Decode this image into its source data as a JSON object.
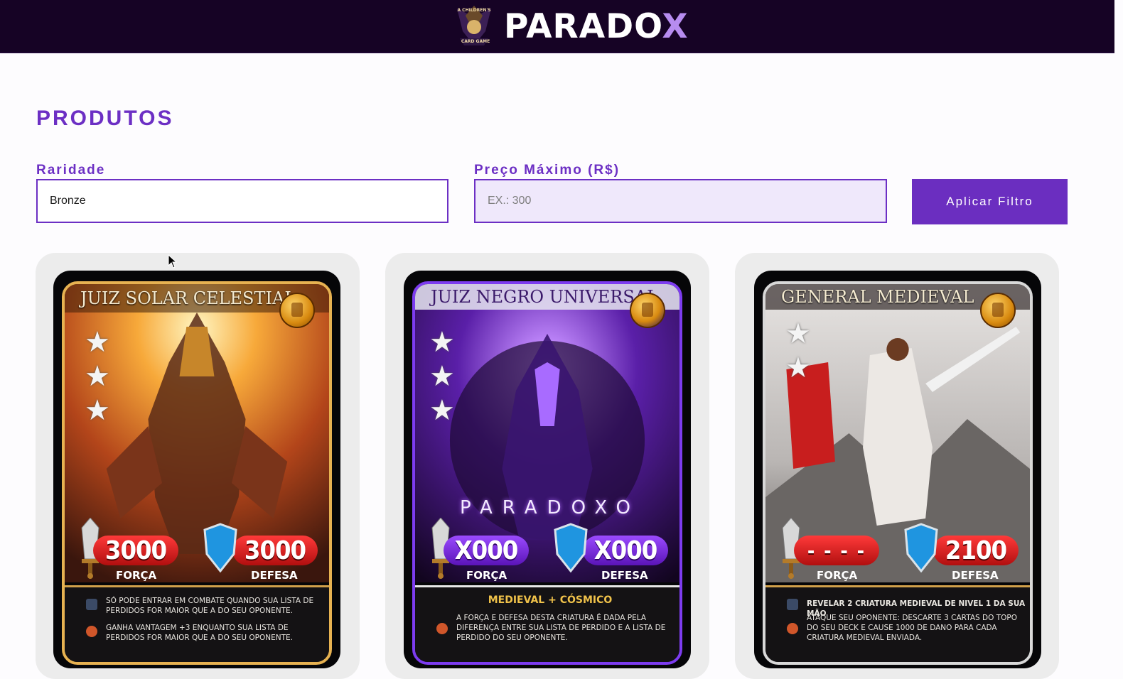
{
  "header": {
    "logo_text": "PARADO",
    "logo_accent": "X",
    "logo_mark_text": "A CHILDREN'S CARD GAME"
  },
  "page": {
    "title": "PRODUTOS"
  },
  "filters": {
    "rarity_label": "Raridade",
    "rarity_value": "Bronze",
    "price_label": "Preço Máximo (R$)",
    "price_placeholder": "EX.: 300",
    "apply_label": "Aplicar Filtro"
  },
  "colors": {
    "accent": "#6c2fc4",
    "header_bg": "#160325",
    "button": "#6b2ec0"
  },
  "cards": [
    {
      "name": "JUIZ SOLAR CELESTIAL",
      "stars": 3,
      "forca": "3000",
      "defesa": "3000",
      "forca_label": "FORÇA",
      "defesa_label": "DEFESA",
      "effects": [
        "SÓ PODE ENTRAR EM COMBATE QUANDO SUA LISTA DE PERDIDOS FOR MAIOR QUE A DO SEU OPONENTE.",
        "GANHA VANTAGEM +3 ENQUANTO SUA LISTA DE PERDIDOS FOR MAIOR QUE A DO SEU OPONENTE."
      ]
    },
    {
      "name": "JUIZ NEGRO UNIVERSAL",
      "stars": 3,
      "watermark": "PARADOXO",
      "forca": "X000",
      "defesa": "X000",
      "forca_label": "FORÇA",
      "defesa_label": "DEFESA",
      "subtitle": "MEDIEVAL + CÓSMICO",
      "effects": [
        "A FORÇA E DEFESA DESTA CRIATURA É DADA PELA DIFERENÇA ENTRE SUA LISTA DE PERDIDO E A LISTA DE PERDIDO DO SEU OPONENTE."
      ]
    },
    {
      "name": "GENERAL MEDIEVAL",
      "stars": 2,
      "forca": "- - - -",
      "defesa": "2100",
      "forca_label": "FORÇA",
      "defesa_label": "DEFESA",
      "effects": [
        "REVELAR 2 CRIATURA MEDIEVAL DE NIVEL 1 DA SUA MÃO",
        "ATAQUE SEU OPONENTE: DESCARTE 3 CARTAS DO TOPO DO SEU DECK E CAUSE 1000 DE DANO PARA CADA CRIATURA MEDIEVAL ENVIADA."
      ]
    }
  ]
}
